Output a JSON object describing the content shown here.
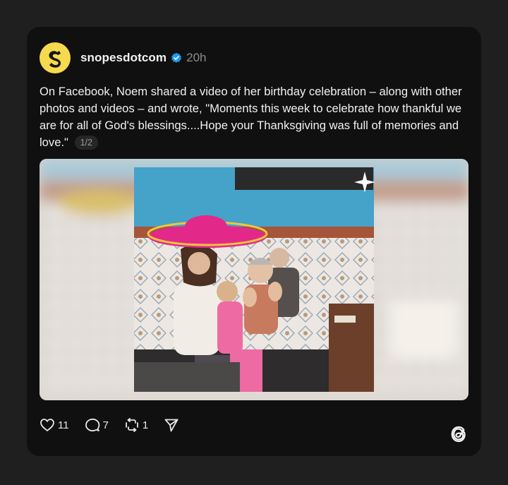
{
  "post": {
    "username": "snopesdotcom",
    "time": "20h",
    "text": "On Facebook, Noem shared a video of her birthday celebration – along with other photos and videos – and wrote, \"Moments this week to celebrate how thankful we are for all of God's blessings....Hope your Thanksgiving was full of memories and love.\"",
    "pager": "1/2"
  },
  "actions": {
    "likes": "11",
    "replies": "7",
    "reposts": "1"
  },
  "colors": {
    "background": "#1f1f1f",
    "card": "#101010",
    "avatar": "#f6d94e",
    "verified": "#1d9bf0",
    "muted_text": "#8d8d8d"
  },
  "icons": [
    "snopes-logo-icon",
    "verified-icon",
    "heart-icon",
    "comment-icon",
    "repost-icon",
    "share-icon",
    "threads-logo-icon"
  ]
}
